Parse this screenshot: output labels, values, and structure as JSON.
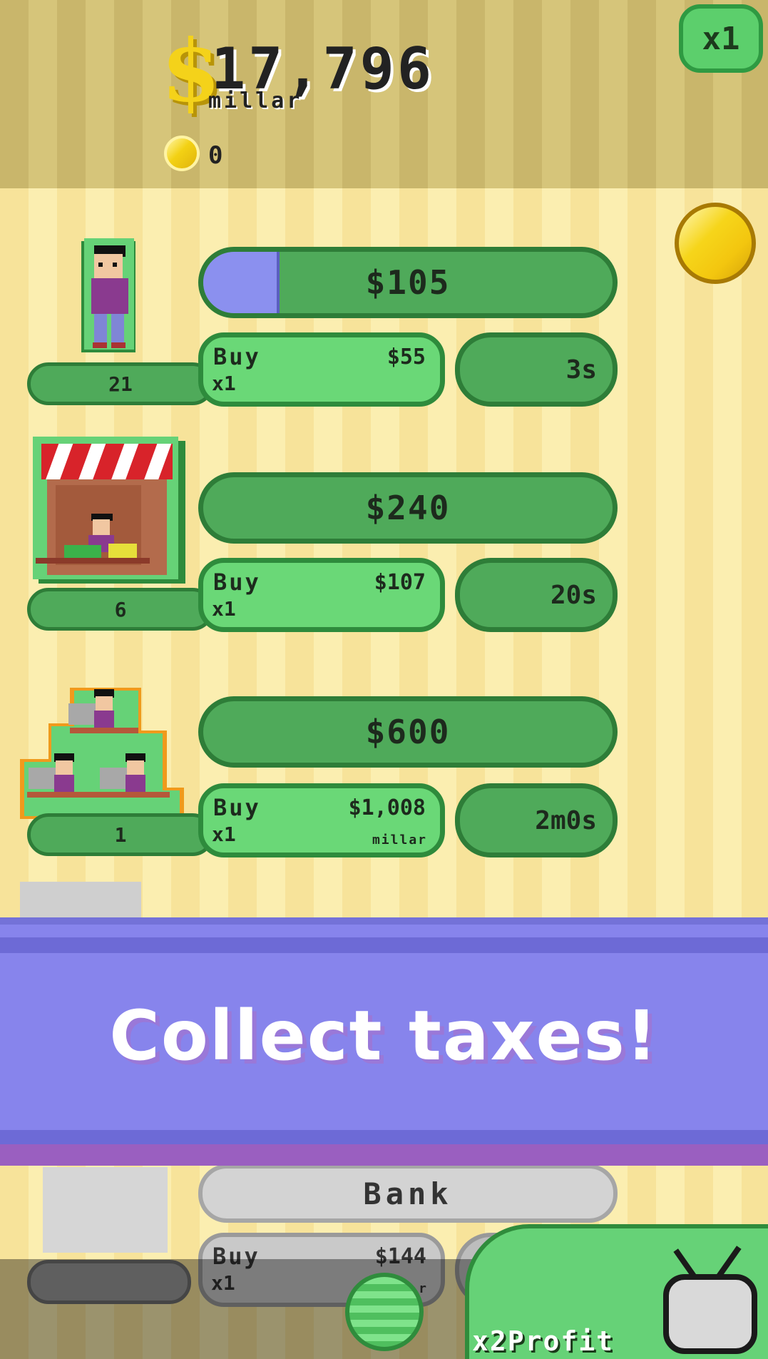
{
  "header": {
    "money_symbol": "$",
    "money_value": "17,796",
    "money_unit": "millar",
    "coins": "0",
    "multiplier": "x1"
  },
  "businesses": [
    {
      "name": "person",
      "profit": "$105",
      "progress": 0.18,
      "buy_label": "Buy",
      "buy_qty": "x1",
      "buy_cost": "$55",
      "buy_unit": "",
      "time": "3s",
      "count": "21"
    },
    {
      "name": "stand",
      "profit": "$240",
      "progress": 0,
      "buy_label": "Buy",
      "buy_qty": "x1",
      "buy_cost": "$107",
      "buy_unit": "",
      "time": "20s",
      "count": "6"
    },
    {
      "name": "office",
      "profit": "$600",
      "progress": 0,
      "buy_label": "Buy",
      "buy_qty": "x1",
      "buy_cost": "$1,008",
      "buy_unit": "millar",
      "time": "2m0s",
      "count": "1"
    }
  ],
  "banner": {
    "text": "Collect taxes!"
  },
  "locked": {
    "name": "Bank",
    "buy_label": "Buy",
    "buy_qty": "x1",
    "buy_cost": "$144",
    "buy_unit": "r"
  },
  "footer": {
    "tv_label": "x2Profit"
  },
  "colors": {
    "accent_green": "#4faa5a",
    "buy_green": "#6ad877",
    "banner_purple": "#8784ec",
    "coin_gold": "#f3d114"
  }
}
